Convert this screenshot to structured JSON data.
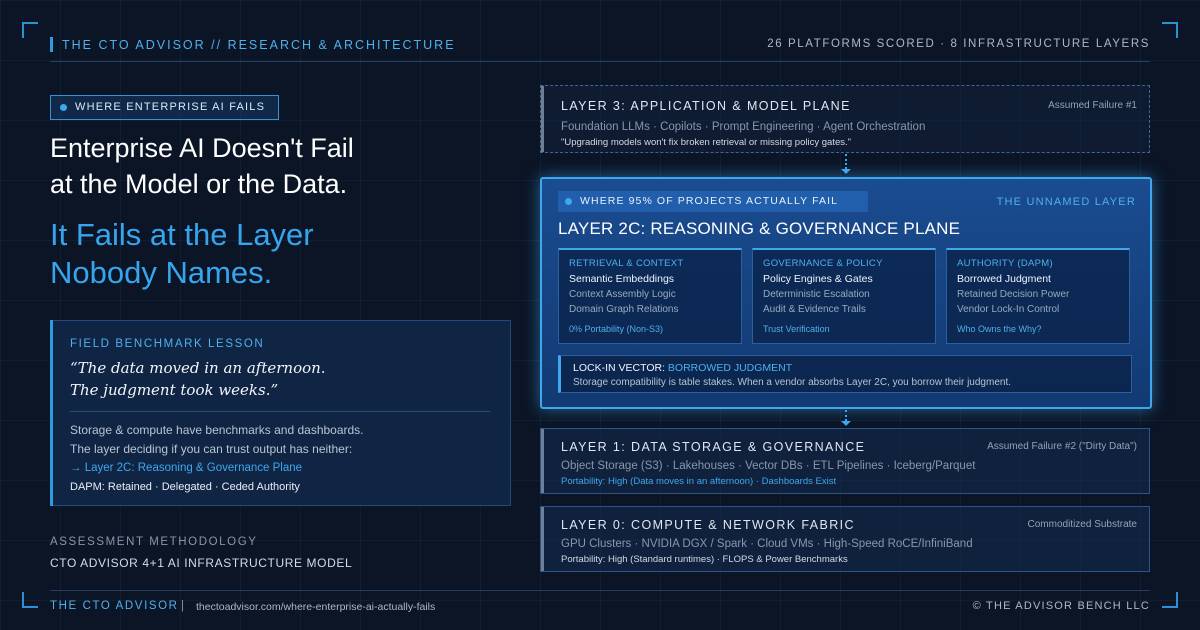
{
  "header": {
    "left": "THE CTO ADVISOR // RESEARCH & ARCHITECTURE",
    "right": "26 PLATFORMS SCORED · 8 INFRASTRUCTURE LAYERS"
  },
  "hero": {
    "badge": "WHERE ENTERPRISE AI FAILS",
    "headline_line1": "Enterprise AI Doesn't Fail",
    "headline_line2": "at the Model or the Data.",
    "subhead_line1": "It Fails at the Layer",
    "subhead_line2": "Nobody Names."
  },
  "lesson": {
    "title": "FIELD BENCHMARK LESSON",
    "quote_line1": "“The data moved in an afternoon.",
    "quote_line2": "The judgment took weeks.”",
    "body_line1": "Storage & compute have benchmarks and dashboards.",
    "body_line2": "The layer deciding if you can trust output has neither:",
    "link": "→ Layer 2C: Reasoning & Governance Plane",
    "dapm": "DAPM: Retained · Delegated · Ceded Authority"
  },
  "methodology": {
    "title": "ASSESSMENT METHODOLOGY",
    "name": "CTO ADVISOR 4+1 AI INFRASTRUCTURE MODEL"
  },
  "footer": {
    "brand": "THE CTO ADVISOR",
    "separator": "|",
    "url": "thectoadvisor.com/where-enterprise-ai-actually-fails",
    "copyright": "© THE ADVISOR BENCH LLC"
  },
  "layers": {
    "l3": {
      "title": "LAYER 3: APPLICATION & MODEL PLANE",
      "tag": "Assumed Failure #1",
      "items": "Foundation LLMs · Copilots · Prompt Engineering · Agent Orchestration",
      "note": "\"Upgrading models won't fix broken retrieval or missing policy gates.\""
    },
    "l2c": {
      "badge": "WHERE 95% OF PROJECTS ACTUALLY FAIL",
      "tag": "THE UNNAMED LAYER",
      "title": "LAYER 2C: REASONING & GOVERNANCE PLANE",
      "columns": [
        {
          "heading": "RETRIEVAL & CONTEXT",
          "items": [
            "Semantic Embeddings",
            "Context Assembly Logic",
            "Domain Graph Relations"
          ],
          "footer": "0% Portability (Non-S3)"
        },
        {
          "heading": "GOVERNANCE & POLICY",
          "items": [
            "Policy Engines & Gates",
            "Deterministic Escalation",
            "Audit & Evidence Trails"
          ],
          "footer": "Trust Verification"
        },
        {
          "heading": "AUTHORITY (DAPM)",
          "items": [
            "Borrowed Judgment",
            "Retained Decision Power",
            "Vendor Lock-In Control"
          ],
          "footer": "Who Owns the Why?"
        }
      ],
      "lock_label": "LOCK-IN VECTOR:",
      "lock_value": "BORROWED JUDGMENT",
      "lock_body": "Storage compatibility is table stakes. When a vendor absorbs Layer 2C, you borrow their judgment."
    },
    "l1": {
      "title": "LAYER 1: DATA STORAGE & GOVERNANCE",
      "tag": "Assumed Failure #2 (\"Dirty Data\")",
      "items": "Object Storage (S3) · Lakehouses · Vector DBs · ETL Pipelines · Iceberg/Parquet",
      "note": "Portability: High (Data moves in an afternoon) · Dashboards Exist"
    },
    "l0": {
      "title": "LAYER 0: COMPUTE & NETWORK FABRIC",
      "tag": "Commoditized Substrate",
      "items": "GPU Clusters · NVIDIA DGX / Spark · Cloud VMs · High-Speed RoCE/InfiniBand",
      "note": "Portability: High (Standard runtimes) · FLOPS & Power Benchmarks"
    }
  },
  "colors": {
    "background": "#0b1526",
    "accent": "#3fa7ee",
    "highlight_border": "#3fa7ee"
  }
}
